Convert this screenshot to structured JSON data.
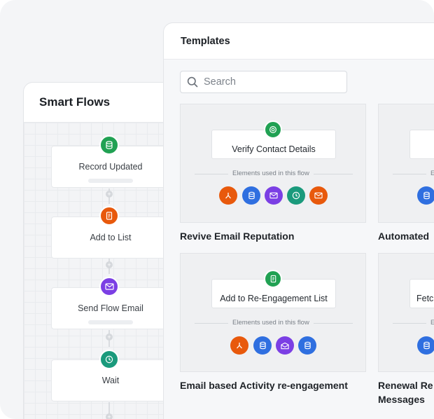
{
  "smart_flows": {
    "title": "Smart Flows",
    "nodes": [
      {
        "label": "Record Updated",
        "icon": "database-icon",
        "color": "#21a153"
      },
      {
        "label": "Add to List",
        "icon": "list-icon",
        "color": "#e8590c"
      },
      {
        "label": "Send Flow Email",
        "icon": "envelope-icon",
        "color": "#7b3fe4"
      },
      {
        "label": "Wait",
        "icon": "clock-icon",
        "color": "#1a9a7c"
      }
    ]
  },
  "templates": {
    "title": "Templates",
    "search_placeholder": "Search",
    "elements_label": "Elements used in this flow",
    "cards": [
      {
        "node_label": "Verify Contact Details",
        "name": "Revive Email Reputation"
      },
      {
        "node_label": "",
        "name": "Automated"
      },
      {
        "node_label": "Add to Re-Engagement List",
        "name": "Email based Activity re-engagement"
      },
      {
        "node_label": "Fetc",
        "name_line1": "Renewal Re",
        "name_line2": "Messages"
      }
    ]
  },
  "colors": {
    "green": "#21a153",
    "orange": "#e8590c",
    "blue": "#2f6fe0",
    "purple": "#7b3fe4",
    "teal": "#1a9a7c"
  }
}
